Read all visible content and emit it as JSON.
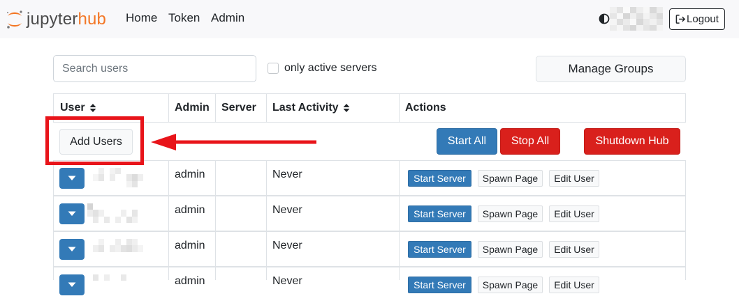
{
  "navbar": {
    "logo_text_main": "jupyter",
    "logo_text_accent": "hub",
    "links": [
      "Home",
      "Token",
      "Admin"
    ],
    "logout_label": "Logout"
  },
  "controls": {
    "search_placeholder": "Search users",
    "search_value": "",
    "active_checkbox_label": "only active servers",
    "active_checkbox_checked": false,
    "manage_groups_label": "Manage Groups"
  },
  "table": {
    "headers": {
      "user": "User",
      "admin": "Admin",
      "server": "Server",
      "last_activity": "Last Activity",
      "actions": "Actions"
    },
    "add_users_label": "Add Users",
    "start_all_label": "Start All",
    "stop_all_label": "Stop All",
    "shutdown_hub_label": "Shutdown Hub",
    "rows": [
      {
        "admin": "admin",
        "server": "",
        "last_activity": "Never",
        "start_label": "Start Server",
        "spawn_label": "Spawn Page",
        "edit_label": "Edit User"
      },
      {
        "admin": "admin",
        "server": "",
        "last_activity": "Never",
        "start_label": "Start Server",
        "spawn_label": "Spawn Page",
        "edit_label": "Edit User"
      },
      {
        "admin": "admin",
        "server": "",
        "last_activity": "Never",
        "start_label": "Start Server",
        "spawn_label": "Spawn Page",
        "edit_label": "Edit User"
      },
      {
        "admin": "admin",
        "server": "",
        "last_activity": "Never",
        "start_label": "Start Server",
        "spawn_label": "Spawn Page",
        "edit_label": "Edit User"
      }
    ]
  },
  "annotation": {
    "highlight_color": "#e8141a"
  },
  "colors": {
    "primary": "#337ab7",
    "danger": "#d9201c",
    "brand_orange": "#f37726"
  },
  "icons": {
    "logo": "jupyter-logo-icon",
    "theme_toggle": "half-circle-contrast-icon",
    "logout": "sign-out-icon",
    "sort": "sort-updown-icon",
    "row_toggle": "caret-down-icon",
    "annotation_arrow": "arrow-left-icon"
  }
}
